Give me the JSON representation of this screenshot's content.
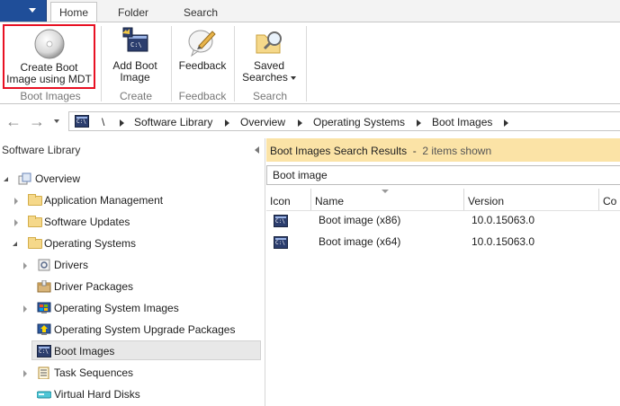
{
  "tabs": [
    {
      "label": "Home",
      "active": true
    },
    {
      "label": "Folder",
      "active": false
    },
    {
      "label": "Search",
      "active": false
    }
  ],
  "ribbon": {
    "buttons": {
      "create_boot_image": {
        "line1": "Create Boot",
        "line2": "Image using MDT",
        "icon": "disc-icon",
        "highlighted": true
      },
      "add_boot_image": {
        "line1": "Add Boot",
        "line2": "Image",
        "icon": "console-add-icon"
      },
      "feedback": {
        "line1": "Feedback",
        "icon": "feedback-pen-icon"
      },
      "saved_searches": {
        "line1": "Saved",
        "line2": "Searches",
        "icon": "folder-search-icon"
      }
    },
    "groups": [
      "Boot Images",
      "Create",
      "Feedback",
      "Search"
    ]
  },
  "address": {
    "root_sep": "\\",
    "crumbs": [
      "Software Library",
      "Overview",
      "Operating Systems",
      "Boot Images"
    ]
  },
  "nav": {
    "header": "Software Library",
    "items": [
      {
        "label": "Overview",
        "icon": "overview-icon",
        "level": 0,
        "expand": "open"
      },
      {
        "label": "Application Management",
        "icon": "folder-icon",
        "level": 1,
        "expand": "closed"
      },
      {
        "label": "Software Updates",
        "icon": "folder-icon",
        "level": 1,
        "expand": "closed"
      },
      {
        "label": "Operating Systems",
        "icon": "folder-icon",
        "level": 1,
        "expand": "open"
      },
      {
        "label": "Drivers",
        "icon": "driver-icon",
        "level": 2,
        "expand": "closed"
      },
      {
        "label": "Driver Packages",
        "icon": "package-icon",
        "level": 2,
        "expand": "none"
      },
      {
        "label": "Operating System Images",
        "icon": "os-image-icon",
        "level": 2,
        "expand": "closed"
      },
      {
        "label": "Operating System Upgrade Packages",
        "icon": "upgrade-package-icon",
        "level": 2,
        "expand": "none"
      },
      {
        "label": "Boot Images",
        "icon": "console-icon",
        "level": 2,
        "expand": "none",
        "selected": true
      },
      {
        "label": "Task Sequences",
        "icon": "task-sequence-icon",
        "level": 2,
        "expand": "closed"
      },
      {
        "label": "Virtual Hard Disks",
        "icon": "vhd-icon",
        "level": 2,
        "expand": "none"
      }
    ]
  },
  "results": {
    "title": "Boot Images Search Results",
    "separator": "-",
    "count": "2 items shown",
    "search_value": "Boot image",
    "columns": [
      "Icon",
      "Name",
      "Version",
      "Co"
    ],
    "rows": [
      {
        "name": "Boot image (x86)",
        "version": "10.0.15063.0"
      },
      {
        "name": "Boot image (x64)",
        "version": "10.0.15063.0"
      }
    ]
  },
  "colors": {
    "app_menu": "#1f4e99",
    "results_header": "#fbe3a6",
    "highlight_border": "#e81123"
  }
}
